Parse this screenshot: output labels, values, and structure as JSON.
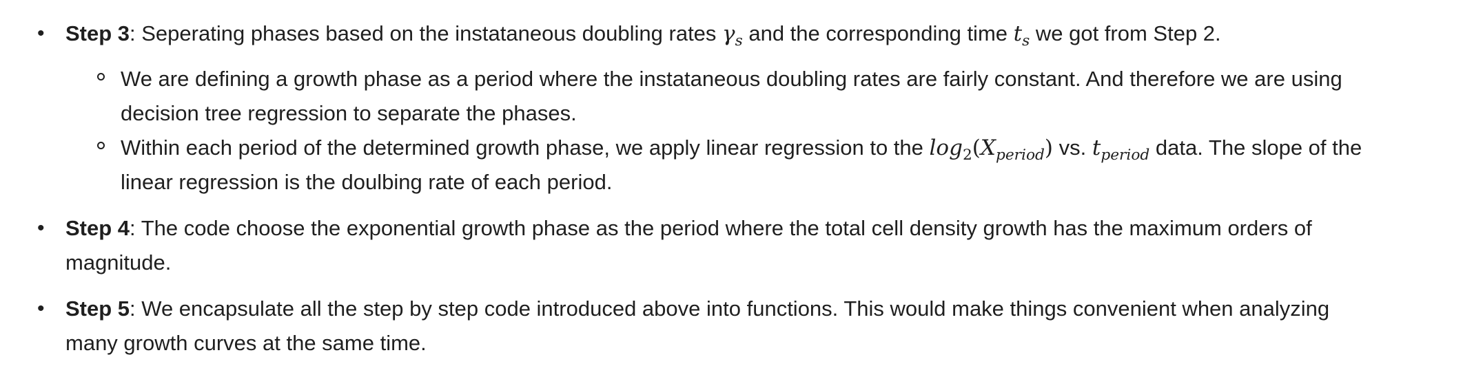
{
  "items": [
    {
      "label": "Step 3",
      "text_a": ": Seperating phases based on the instataneous doubling rates ",
      "math_gamma": "γ",
      "math_gamma_sub": "s",
      "text_b": " and the corresponding time ",
      "math_t": "t",
      "math_t_sub": "s",
      "text_c": " we got from Step 2.",
      "sub": [
        {
          "line1": "We are defining a growth phase as a period where the instataneous doubling rates are fairly constant. And therefore we are using",
          "line2": "decision tree regression to separate the phases."
        },
        {
          "text_a": "Within each period of the determined growth phase, we apply linear regression to the ",
          "math_log": "log",
          "math_log_sub": "2",
          "math_open": "(",
          "math_X": "X",
          "math_X_sub": "period",
          "math_close": ")",
          "text_b": " vs. ",
          "math_t": "t",
          "math_t_sub": "period",
          "text_c": " data. The slope of the",
          "line2": "linear regression is the doulbing rate of each period."
        }
      ]
    },
    {
      "label": "Step 4",
      "line1": ": The code choose the exponential growth phase as the period where the total cell density growth has the maximum orders of",
      "line2": "magnitude."
    },
    {
      "label": "Step 5",
      "line1": ": We encapsulate all the step by step code introduced above into functions. This would make things convenient when analyzing",
      "line2": "many growth curves at the same time."
    }
  ]
}
